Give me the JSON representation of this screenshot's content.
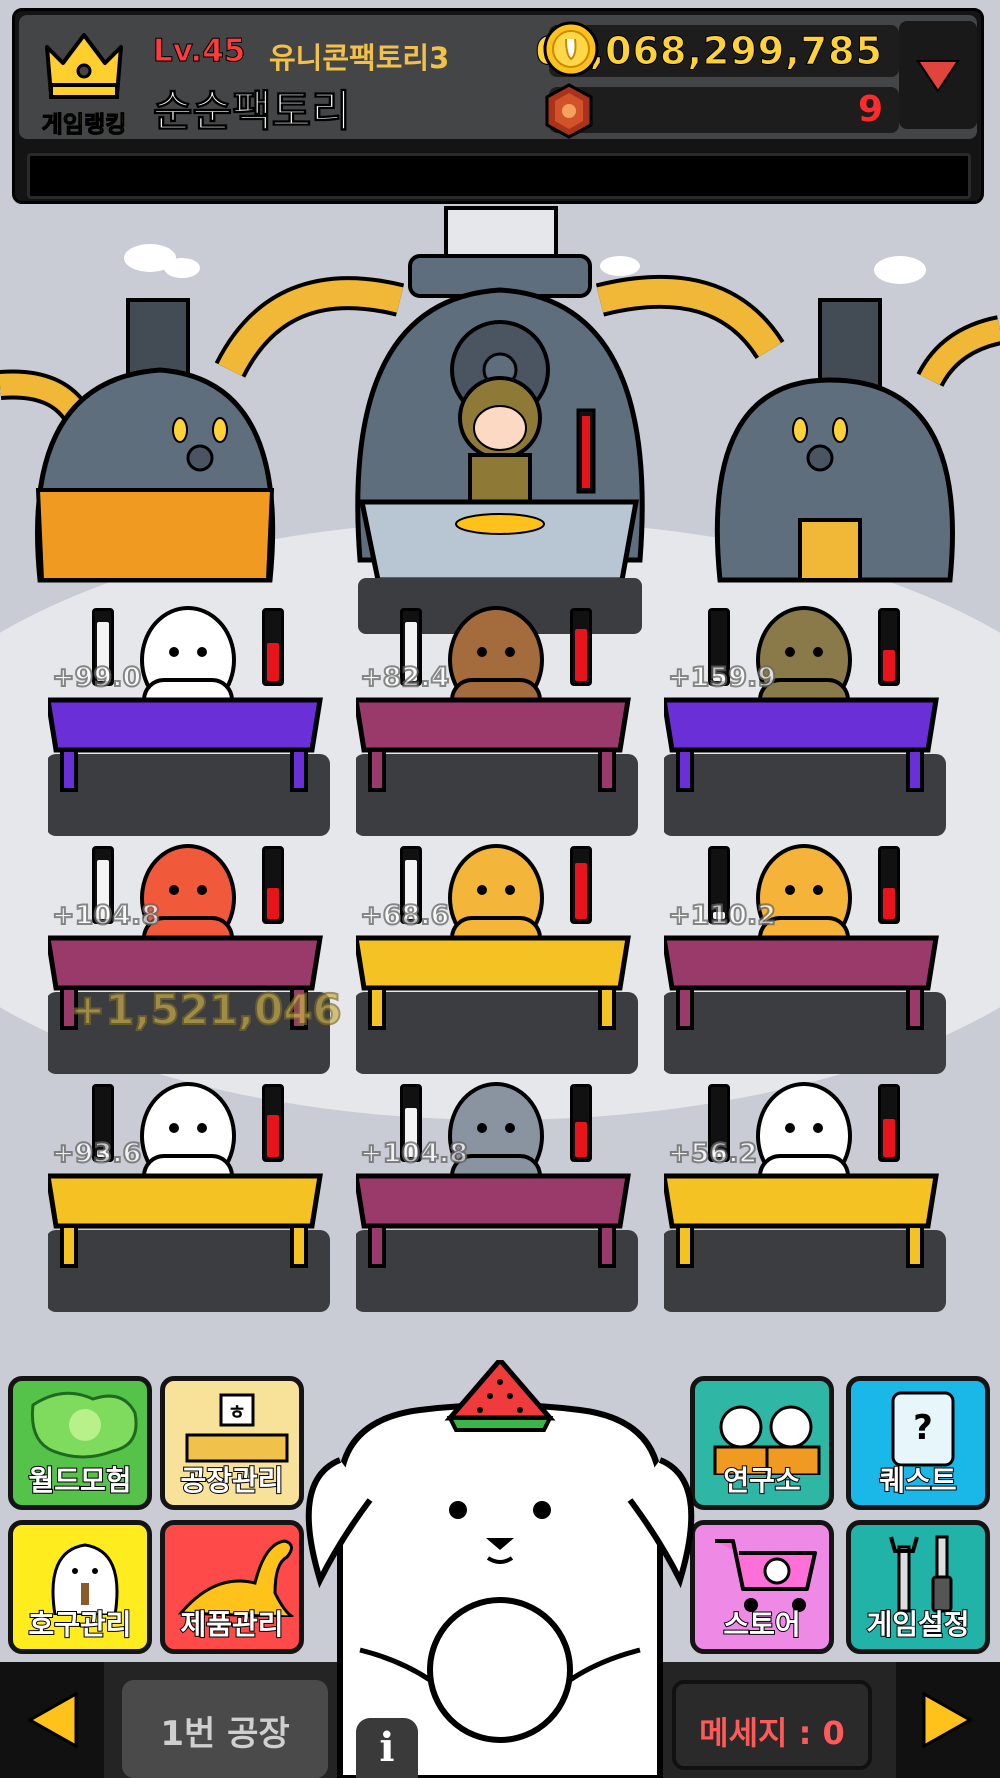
{
  "header": {
    "ranking_label": "게임랭킹",
    "level": "Lv.45",
    "factory_name": "유니콘팩토리3",
    "player_name": "순순팩토리",
    "gold": "62,068,299,785",
    "gems": "9",
    "message_strip": ""
  },
  "stations": [
    {
      "worker": "rabbit",
      "rate": "+99.0",
      "desk": "purple-ocean",
      "left_gauge": 0.85,
      "right_gauge": 0.55
    },
    {
      "worker": "cow",
      "rate": "+82.4",
      "desk": "maroon-craft",
      "left_gauge": 0.85,
      "right_gauge": 0.75
    },
    {
      "worker": "ghost-blob",
      "rate": "+159.9",
      "desk": "purple-ocean",
      "left_gauge": 0.1,
      "right_gauge": 0.45
    },
    {
      "worker": "carrot",
      "rate": "+104.8",
      "desk": "maroon-craft",
      "left_gauge": 0.85,
      "right_gauge": 0.45
    },
    {
      "worker": "giraffe",
      "rate": "+68.6",
      "desk": "yellow",
      "left_gauge": 0.85,
      "right_gauge": 0.8
    },
    {
      "worker": "shiba",
      "rate": "+110.2",
      "desk": "maroon-craft",
      "left_gauge": 0.1,
      "right_gauge": 0.45
    },
    {
      "worker": "square-bot",
      "rate": "+93.6",
      "desk": "yellow",
      "left_gauge": 0.1,
      "right_gauge": 0.6
    },
    {
      "worker": "pigeon",
      "rate": "+104.8",
      "desk": "maroon-craft",
      "left_gauge": 0.7,
      "right_gauge": 0.5
    },
    {
      "worker": "chicken",
      "rate": "+56.2",
      "desk": "yellow",
      "left_gauge": 0.1,
      "right_gauge": 0.55
    }
  ],
  "popup_amount": "+1,521,046",
  "menu": {
    "world_adventure": "월드모험",
    "factory_manage": "공장관리",
    "customer_manage": "호구관리",
    "product_manage": "제품관리",
    "lab": "연구소",
    "quest": "퀘스트",
    "store": "스토어",
    "settings": "게임설정"
  },
  "bottom": {
    "factory_selector": "1번 공장",
    "message_count": "메세지 : 0",
    "info": "i"
  },
  "colors": {
    "gold_text": "#ffd23a",
    "level_red": "#ff3b3b",
    "gauge_red": "#e8141b",
    "gauge_white": "#f4f4f4",
    "desk_yellow": "#f5c223"
  }
}
